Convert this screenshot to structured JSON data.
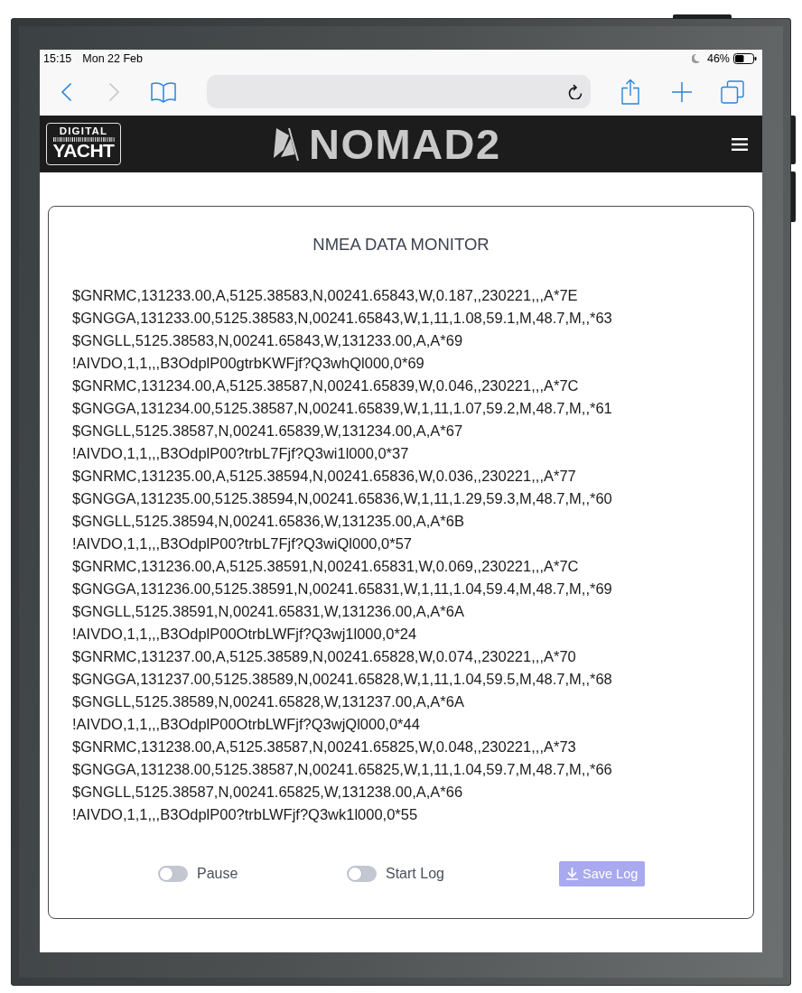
{
  "status_bar": {
    "time": "15:15",
    "date": "Mon 22 Feb",
    "battery": "46%"
  },
  "browser_toolbar": {
    "left_buttons": [
      {
        "kind": "back",
        "disabled": false
      },
      {
        "kind": "forward",
        "disabled": true
      },
      {
        "kind": "bookmarks",
        "disabled": false
      }
    ],
    "right_buttons": [
      {
        "kind": "share",
        "disabled": false
      },
      {
        "kind": "new_tab",
        "disabled": false
      },
      {
        "kind": "tabs",
        "disabled": false
      }
    ]
  },
  "header": {
    "brand_logo": {
      "top_text": "DIGITAL",
      "bottom_text": "YACHT"
    },
    "product_logo": "NOMAD2"
  },
  "monitor": {
    "title": "NMEA DATA MONITOR",
    "lines": [
      "$GNRMC,131233.00,A,5125.38583,N,00241.65843,W,0.187,,230221,,,A*7E",
      "$GNGGA,131233.00,5125.38583,N,00241.65843,W,1,11,1.08,59.1,M,48.7,M,,*63",
      "$GNGLL,5125.38583,N,00241.65843,W,131233.00,A,A*69",
      "!AIVDO,1,1,,,B3OdplP00gtrbKWFjf?Q3whQl000,0*69",
      "$GNRMC,131234.00,A,5125.38587,N,00241.65839,W,0.046,,230221,,,A*7C",
      "$GNGGA,131234.00,5125.38587,N,00241.65839,W,1,11,1.07,59.2,M,48.7,M,,*61",
      "$GNGLL,5125.38587,N,00241.65839,W,131234.00,A,A*67",
      "!AIVDO,1,1,,,B3OdplP00?trbL7Fjf?Q3wi1l000,0*37",
      "$GNRMC,131235.00,A,5125.38594,N,00241.65836,W,0.036,,230221,,,A*77",
      "$GNGGA,131235.00,5125.38594,N,00241.65836,W,1,11,1.29,59.3,M,48.7,M,,*60",
      "$GNGLL,5125.38594,N,00241.65836,W,131235.00,A,A*6B",
      "!AIVDO,1,1,,,B3OdplP00?trbL7Fjf?Q3wiQl000,0*57",
      "$GNRMC,131236.00,A,5125.38591,N,00241.65831,W,0.069,,230221,,,A*7C",
      "$GNGGA,131236.00,5125.38591,N,00241.65831,W,1,11,1.04,59.4,M,48.7,M,,*69",
      "$GNGLL,5125.38591,N,00241.65831,W,131236.00,A,A*6A",
      "!AIVDO,1,1,,,B3OdplP00OtrbLWFjf?Q3wj1l000,0*24",
      "$GNRMC,131237.00,A,5125.38589,N,00241.65828,W,0.074,,230221,,,A*70",
      "$GNGGA,131237.00,5125.38589,N,00241.65828,W,1,11,1.04,59.5,M,48.7,M,,*68",
      "$GNGLL,5125.38589,N,00241.65828,W,131237.00,A,A*6A",
      "!AIVDO,1,1,,,B3OdplP00OtrbLWFjf?Q3wjQl000,0*44",
      "$GNRMC,131238.00,A,5125.38587,N,00241.65825,W,0.048,,230221,,,A*73",
      "$GNGGA,131238.00,5125.38587,N,00241.65825,W,1,11,1.04,59.7,M,48.7,M,,*66",
      "$GNGLL,5125.38587,N,00241.65825,W,131238.00,A,A*66",
      "!AIVDO,1,1,,,B3OdplP00?trbLWFjf?Q3wk1l000,0*55"
    ],
    "controls": [
      {
        "kind": "toggle",
        "label": "Pause",
        "on": false
      },
      {
        "kind": "toggle",
        "label": "Start Log",
        "on": false
      },
      {
        "kind": "button",
        "label": "Save Log",
        "disabled": true
      }
    ]
  }
}
